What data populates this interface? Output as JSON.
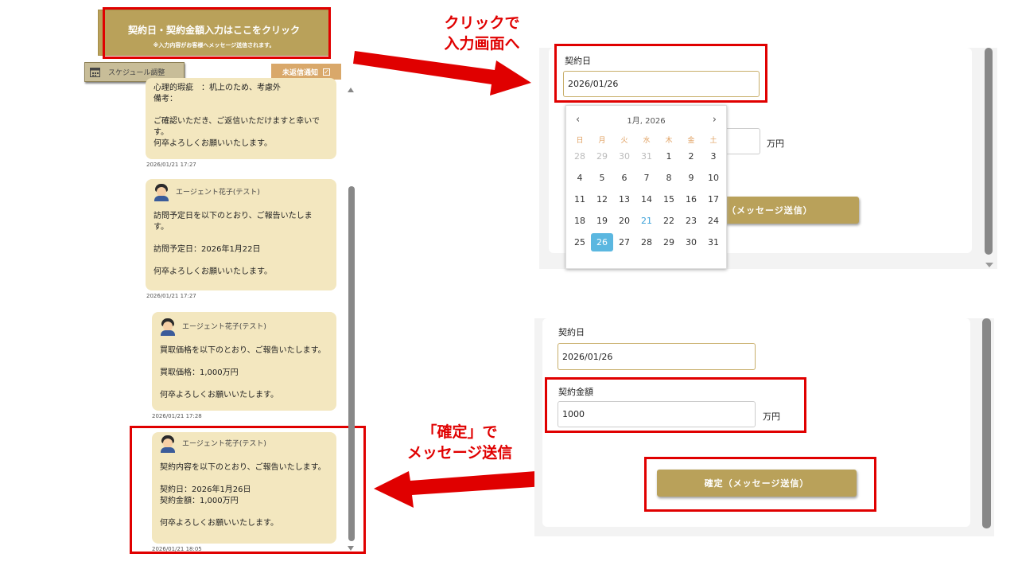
{
  "header": {
    "contract_button_title": "契約日・契約金額入力はここをクリック",
    "contract_button_sub": "※入力内容がお客様へメッセージ送信されます。",
    "schedule_button": "スケジュール調整",
    "unread_button": "未返信通知"
  },
  "chat": {
    "messages": [
      {
        "sender": "",
        "text": "心理的瑕疵　：机上のため、考慮外\n備考：\n\nご確認いただき、ご返信いただけますと幸いで\nす。\n何卒よろしくお願いいたします。",
        "time": "2026/01/21 17:27"
      },
      {
        "sender": "エージェント花子(テスト)",
        "text": "訪問予定日を以下のとおり、ご報告いたしま\nす。\n\n訪問予定日：2026年1月22日\n\n何卒よろしくお願いいたします。",
        "time": "2026/01/21 17:27"
      },
      {
        "sender": "エージェント花子(テスト)",
        "text": "買取価格を以下のとおり、ご報告いたします。\n\n買取価格：1,000万円\n\n何卒よろしくお願いいたします。",
        "time": "2026/01/21 17:28"
      },
      {
        "sender": "エージェント花子(テスト)",
        "text": "契約内容を以下のとおり、ご報告いたします。\n\n契約日：2026年1月26日\n契約金額：1,000万円\n\n何卒よろしくお願いいたします。",
        "time": "2026/01/21 18:05"
      }
    ]
  },
  "form_top": {
    "contract_date_label": "契約日",
    "contract_date_value": "2026/01/26",
    "unit": "万円",
    "submit_partial": "（メッセージ送信）"
  },
  "calendar": {
    "month_label": "1月, 2026",
    "weekdays": [
      "日",
      "月",
      "火",
      "水",
      "木",
      "金",
      "土"
    ],
    "days": [
      [
        "28",
        "29",
        "30",
        "31",
        "1",
        "2",
        "3"
      ],
      [
        "4",
        "5",
        "6",
        "7",
        "8",
        "9",
        "10"
      ],
      [
        "11",
        "12",
        "13",
        "14",
        "15",
        "16",
        "17"
      ],
      [
        "18",
        "19",
        "20",
        "21",
        "22",
        "23",
        "24"
      ],
      [
        "25",
        "26",
        "27",
        "28",
        "29",
        "30",
        "31"
      ]
    ],
    "today": "21",
    "selected": "26"
  },
  "form_bottom": {
    "contract_date_label": "契約日",
    "contract_date_value": "2026/01/26",
    "contract_amount_label": "契約金額",
    "contract_amount_value": "1000",
    "unit": "万円",
    "submit": "確定（メッセージ送信）"
  },
  "callouts": {
    "click_line1": "クリックで",
    "click_line2": "入力画面へ",
    "confirm_line1": "「確定」で",
    "confirm_line2": "メッセージ送信"
  },
  "colors": {
    "gold": "#b9a15a",
    "bubble": "#f3e7bf",
    "accent_red": "#e00000",
    "selected_day": "#5bb7e0"
  }
}
